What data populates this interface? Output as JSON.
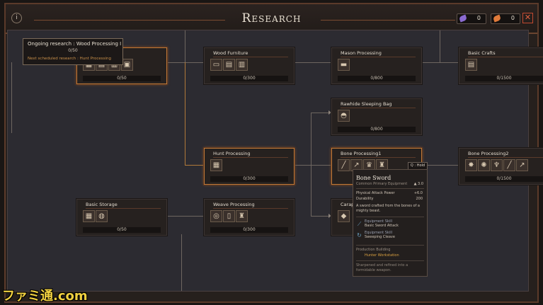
{
  "header": {
    "title": "Research",
    "info_icon": "info-icon",
    "resources": [
      {
        "icon": "feather-purple-icon",
        "value": "0",
        "color": "#8a6ad0"
      },
      {
        "icon": "feather-orange-icon",
        "value": "0",
        "color": "#e07a3a"
      }
    ],
    "close_glyph": "✕"
  },
  "ongoing": {
    "title": "Ongoing research : Wood Processing I",
    "progress": "0/50",
    "next": "Next scheduled research : Hunt Processing"
  },
  "nodes": {
    "wood_processing": {
      "progress": "0/50"
    },
    "wood_furniture": {
      "name": "Wood Furniture",
      "progress": "0/300"
    },
    "mason_processing": {
      "name": "Mason Processing",
      "progress": "0/800"
    },
    "basic_crafts": {
      "name": "Basic Crafts",
      "progress": "0/1500"
    },
    "rawhide_sleeping_bag": {
      "name": "Rawhide Sleeping Bag",
      "progress": "0/800"
    },
    "hunt_processing": {
      "name": "Hunt Processing",
      "progress": "0/300"
    },
    "bone_processing1": {
      "name": "Bone Processing1"
    },
    "bone_processing2": {
      "name": "Bone Processing2",
      "progress": "0/1500"
    },
    "basic_storage": {
      "name": "Basic Storage",
      "progress": "0/50"
    },
    "weave_processing": {
      "name": "Weave Processing",
      "progress": "0/300"
    },
    "carapace": {
      "name": "Carap"
    }
  },
  "hold_hint": "Q : Hold",
  "tooltip": {
    "name": "Bone Sword",
    "category": "Common Primary Equipment",
    "level": "3.0",
    "stats": [
      {
        "label": "Physical Attack Power",
        "value": "+6.0"
      },
      {
        "label": "Durability",
        "value": "200"
      }
    ],
    "description": "A sword crafted from the bones of a mighty beast.",
    "skills": [
      {
        "label": "Equipment Skill",
        "name": "Basic Sword Attack"
      },
      {
        "label": "Equipment Skill",
        "name": "Sweeping Cleave"
      }
    ],
    "production_label": "Production Building",
    "production_value": "Hunter Workstation",
    "flavor": "Sharpened and refined into a formidable weapon."
  },
  "watermark": "ファミ通.com"
}
